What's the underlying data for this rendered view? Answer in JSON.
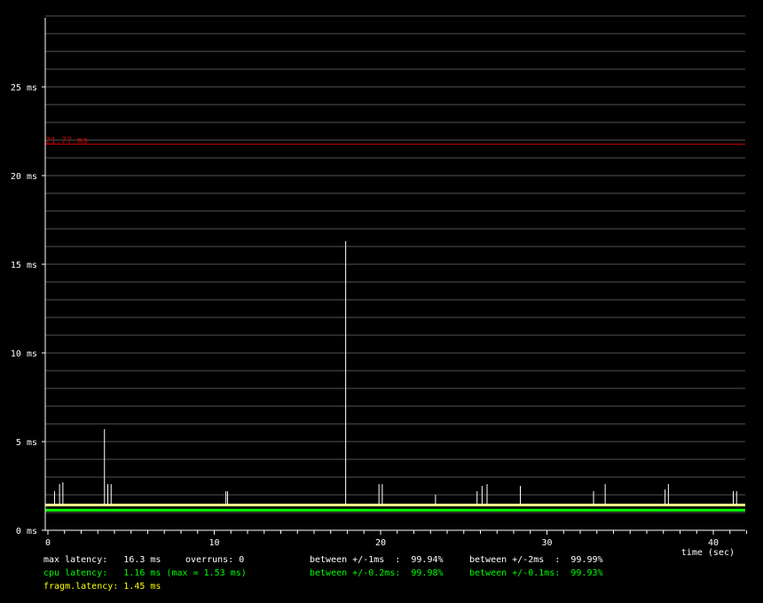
{
  "colors": {
    "background": "#000000",
    "grid": "#555555",
    "axis": "#ffffff",
    "limit_line": "#cc0000",
    "spikes": "#ffffff",
    "fragm_band": "#ffff88",
    "cpu_band": "#00ff00"
  },
  "chart_data": {
    "type": "line",
    "title": "",
    "xlabel": "time (sec)",
    "ylabel": "",
    "xlim": [
      0,
      42
    ],
    "ylim": [
      0,
      29
    ],
    "grid": true,
    "y_ticks": [
      0,
      5,
      10,
      15,
      20,
      25
    ],
    "y_tick_labels": [
      "0 ms",
      "5 ms",
      "10 ms",
      "15 ms",
      "20 ms",
      "25 ms"
    ],
    "x_ticks": [
      0,
      10,
      20,
      30,
      40
    ],
    "x_tick_labels": [
      "0",
      "10",
      "20",
      "30",
      "40"
    ],
    "limit_line": {
      "value": 21.77,
      "label": "21.77 ms"
    },
    "cpu_latency_band": 1.16,
    "fragm_latency_band": 1.45,
    "spikes": [
      {
        "x": 0.4,
        "y": 2.2
      },
      {
        "x": 0.7,
        "y": 2.6
      },
      {
        "x": 0.9,
        "y": 2.7
      },
      {
        "x": 3.4,
        "y": 5.7
      },
      {
        "x": 3.6,
        "y": 2.6
      },
      {
        "x": 3.8,
        "y": 2.6
      },
      {
        "x": 10.7,
        "y": 2.2
      },
      {
        "x": 10.8,
        "y": 2.2
      },
      {
        "x": 17.9,
        "y": 16.3
      },
      {
        "x": 19.9,
        "y": 2.6
      },
      {
        "x": 20.1,
        "y": 2.6
      },
      {
        "x": 23.3,
        "y": 2.0
      },
      {
        "x": 25.8,
        "y": 2.2
      },
      {
        "x": 26.1,
        "y": 2.5
      },
      {
        "x": 26.4,
        "y": 2.6
      },
      {
        "x": 28.4,
        "y": 2.5
      },
      {
        "x": 32.8,
        "y": 2.2
      },
      {
        "x": 33.5,
        "y": 2.6
      },
      {
        "x": 37.1,
        "y": 2.3
      },
      {
        "x": 37.3,
        "y": 2.6
      },
      {
        "x": 41.2,
        "y": 2.2
      },
      {
        "x": 41.4,
        "y": 2.2
      }
    ]
  },
  "stats": {
    "max_latency": "max latency:   16.3 ms",
    "overruns": "overruns: 0",
    "cpu_latency": "cpu latency:   1.16 ms (max = 1.53 ms)",
    "fragm_latency": "fragm.latency: 1.45 ms",
    "between_1ms": "between +/-1ms  :  99.94%",
    "between_2ms": "between +/-2ms  :  99.99%",
    "between_02ms": "between +/-0.2ms:  99.98%",
    "between_01ms": "between +/-0.1ms:  99.93%"
  }
}
